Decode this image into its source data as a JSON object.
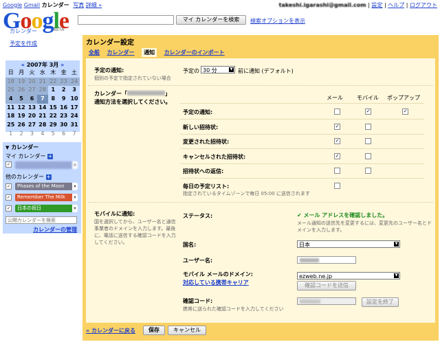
{
  "topnav": {
    "items": [
      "Google",
      "Gmail",
      "カレンダー",
      "写真",
      "詳細 »"
    ]
  },
  "topright": {
    "email": "takeshi.igarashi@gmail.com",
    "sep": "|",
    "settings": "設定",
    "help": "ヘルプ",
    "logout": "ログアウト"
  },
  "logo": {
    "text": "Google",
    "sub": "カレンダー",
    "beta": "BETA"
  },
  "search": {
    "button": "マイ カレンダーを検索",
    "options": "検索オプションを表示"
  },
  "create": "予定を作成",
  "minical": {
    "title": "2007年 3月",
    "prev": "«",
    "next": "»",
    "dow": [
      "日",
      "月",
      "火",
      "水",
      "木",
      "金",
      "土"
    ],
    "weeks": [
      [
        "18",
        "19",
        "20",
        "21",
        "22",
        "23",
        "24"
      ],
      [
        "25",
        "26",
        "27",
        "28",
        "1",
        "2",
        "3"
      ],
      [
        "4",
        "5",
        "6",
        "7",
        "8",
        "9",
        "10"
      ],
      [
        "11",
        "12",
        "13",
        "14",
        "15",
        "16",
        "17"
      ],
      [
        "18",
        "19",
        "20",
        "21",
        "22",
        "23",
        "24"
      ],
      [
        "25",
        "26",
        "27",
        "28",
        "29",
        "30",
        "31"
      ],
      [
        "1",
        "2",
        "3",
        "4",
        "5",
        "6",
        "7"
      ]
    ]
  },
  "callist": {
    "header": "カレンダー",
    "my": "マイ カレンダー",
    "other": "他のカレンダー",
    "others": [
      {
        "name": "Phases of the Moon",
        "color": "#7a7a8c"
      },
      {
        "name": "Remember The Milk",
        "color": "#d8542f"
      },
      {
        "name": "日本の祝日",
        "color": "#2f9a27"
      }
    ],
    "add_placeholder": "公開カレンダーを検索",
    "manage": "カレンダーの管理"
  },
  "settings": {
    "title": "カレンダー設定",
    "tabs": [
      "全般",
      "カレンダー",
      "通知",
      "カレンダーのインポート"
    ],
    "active_tab": "通知",
    "default_notify": {
      "label": "予定の通知:",
      "hint": "個別の予定で指定されていない場合",
      "pre": "予定の",
      "value": "30 分",
      "post": "前に通知 (デフォルト)"
    },
    "method": {
      "label_pre": "カレンダー「",
      "label_post": "」",
      "label2": "通知方法を選択してください。"
    },
    "columns": [
      "メール",
      "モバイル",
      "ポップアップ"
    ],
    "rows": [
      {
        "label": "予定の通知:",
        "mail": false,
        "mobile": true,
        "popup": true
      },
      {
        "label": "新しい招待状:",
        "mail": true,
        "mobile": false,
        "popup": null
      },
      {
        "label": "変更された招待状:",
        "mail": true,
        "mobile": false,
        "popup": null
      },
      {
        "label": "キャンセルされた招待状:",
        "mail": true,
        "mobile": false,
        "popup": null
      },
      {
        "label": "招待状への返信:",
        "mail": false,
        "mobile": false,
        "popup": null
      },
      {
        "label": "毎日の予定リスト:",
        "sub": "指定されているタイムゾーンで毎日 05:00 に送信されます",
        "mail": false,
        "mobile": null,
        "popup": null
      }
    ],
    "mobile": {
      "label": "モバイルに通知:",
      "desc": "国を選択してから、ユーザー名と通信事業者のドメインを入力します。最後に、電話に送信する確認コードを入力してください。",
      "status_label": "ステータス:",
      "status_check": "✔",
      "status_ok": "メール アドレスを確認しました。",
      "status_hint": "メール通知の送信先を変更するには、変更先のユーザー名とドメインを入力します。",
      "country_label": "国名:",
      "country_value": "日本",
      "user_label": "ユーザー名:",
      "domain_label": "モバイル メールのドメイン:",
      "domain_link": "対応している携帯キャリア",
      "domain_value": "ezweb.ne.jp",
      "send_code": "確認コードを送信",
      "code_label": "確認コード:",
      "code_hint": "携帯に送られた確認コードを入力してください",
      "finish": "設定を終了"
    },
    "back": "« カレンダーに戻る",
    "save": "保存",
    "cancel": "キャンセル"
  }
}
